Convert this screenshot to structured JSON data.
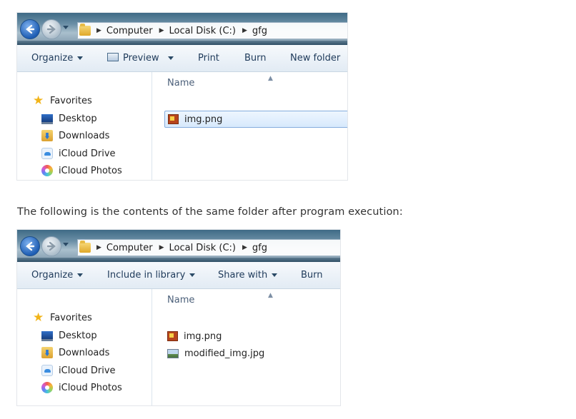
{
  "before": {
    "breadcrumb": [
      "Computer",
      "Local Disk (C:)",
      "gfg"
    ],
    "toolbar": [
      "Organize",
      "Preview",
      "Print",
      "Burn",
      "New folder"
    ],
    "nav": [
      "Favorites",
      "Desktop",
      "Downloads",
      "iCloud Drive",
      "iCloud Photos"
    ],
    "column_header": "Name",
    "files": [
      "img.png"
    ]
  },
  "caption": "The following is the contents of the same folder after program execution:",
  "after": {
    "breadcrumb": [
      "Computer",
      "Local Disk (C:)",
      "gfg"
    ],
    "toolbar": [
      "Organize",
      "Include in library",
      "Share with",
      "Burn"
    ],
    "nav": [
      "Favorites",
      "Desktop",
      "Downloads",
      "iCloud Drive",
      "iCloud Photos"
    ],
    "column_header": "Name",
    "files": [
      "img.png",
      "modified_img.jpg"
    ]
  },
  "icons": {
    "back": "back-arrow-icon",
    "forward": "forward-arrow-icon",
    "folder": "folder-icon",
    "favorites": "star-icon",
    "desktop": "desktop-icon",
    "downloads": "downloads-folder-icon",
    "icloud_drive": "cloud-icon",
    "icloud_photos": "photos-icon",
    "png_file": "png-file-icon",
    "jpg_file": "jpg-file-icon"
  }
}
